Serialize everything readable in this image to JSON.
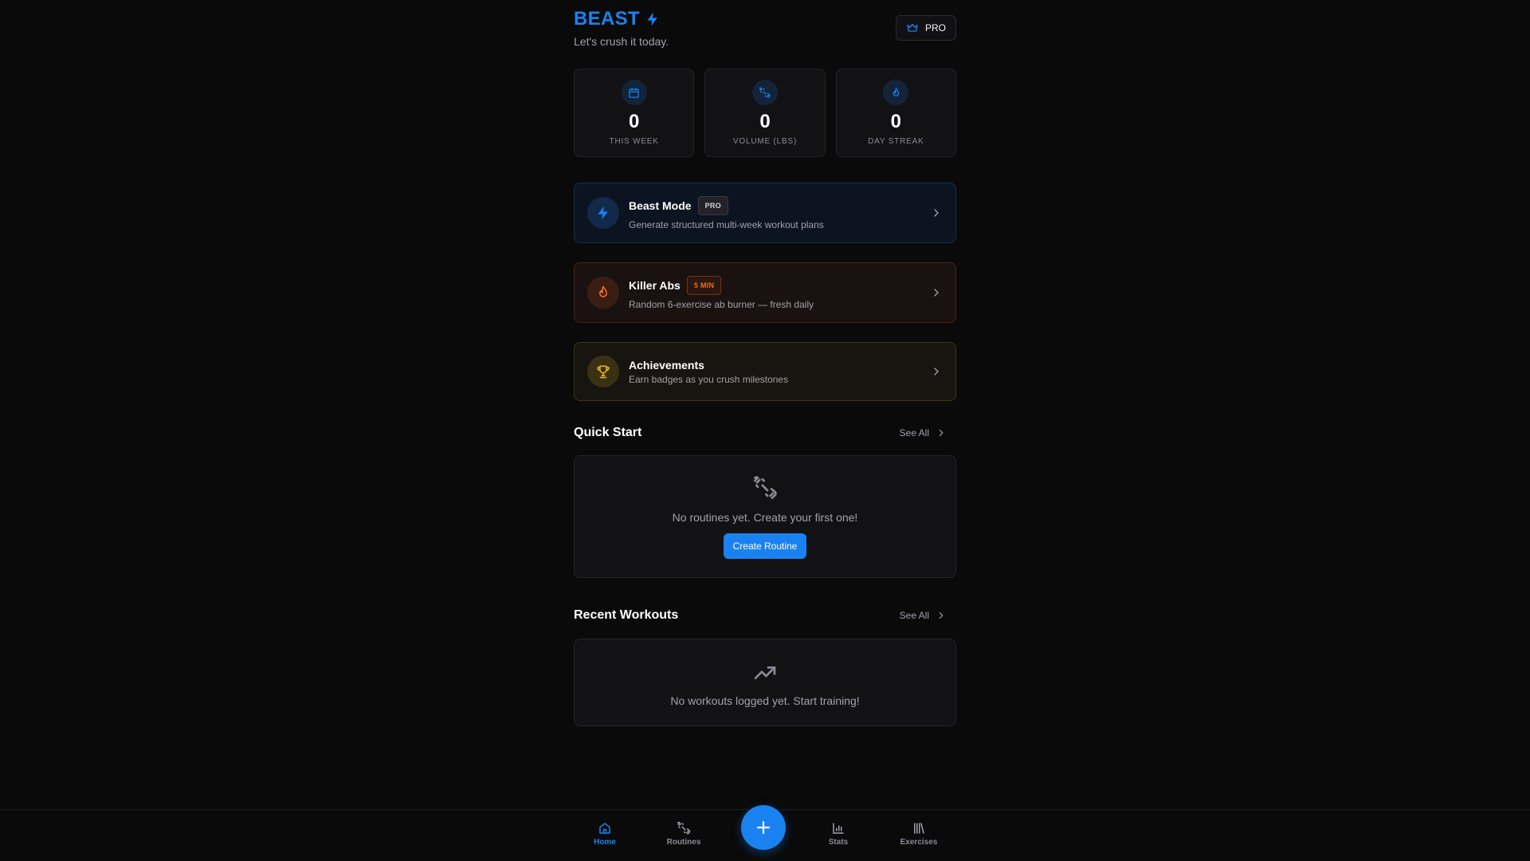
{
  "header": {
    "brand": "BEAST",
    "tagline": "Let's crush it today.",
    "pro_button": "PRO"
  },
  "stats": [
    {
      "icon": "calendar-icon",
      "value": "0",
      "label": "THIS WEEK"
    },
    {
      "icon": "dumbbell-icon",
      "value": "0",
      "label": "VOLUME (LBS)"
    },
    {
      "icon": "flame-icon",
      "value": "0",
      "label": "DAY STREAK"
    }
  ],
  "cards": {
    "beast_mode": {
      "title": "Beast Mode",
      "badge": "PRO",
      "subtitle": "Generate structured multi-week workout plans"
    },
    "killer_abs": {
      "title": "Killer Abs",
      "badge": "5 MIN",
      "subtitle": "Random 6-exercise ab burner — fresh daily"
    },
    "achievements": {
      "title": "Achievements",
      "subtitle": "Earn badges as you crush milestones"
    }
  },
  "quick_start": {
    "title": "Quick Start",
    "see_all": "See All",
    "empty_text": "No routines yet. Create your first one!",
    "create_button": "Create Routine"
  },
  "recent_workouts": {
    "title": "Recent Workouts",
    "see_all": "See All",
    "empty_text": "No workouts logged yet. Start training!"
  },
  "nav": {
    "home": "Home",
    "routines": "Routines",
    "stats": "Stats",
    "exercises": "Exercises",
    "active": "Home"
  },
  "colors": {
    "accent": "#1a82f0",
    "orange": "#f06b1e",
    "gold": "#e0b020",
    "background": "#0a0a0b"
  }
}
